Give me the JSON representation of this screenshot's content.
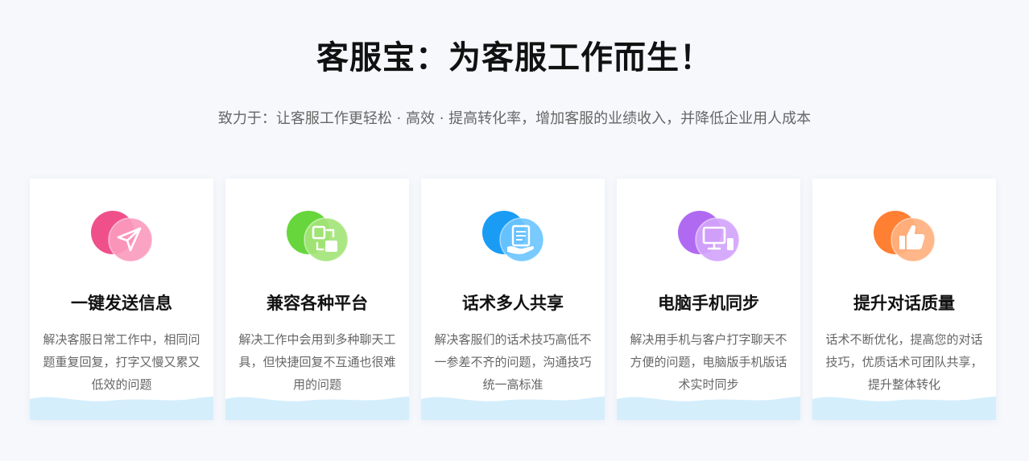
{
  "header": {
    "title": "客服宝：为客服工作而生！",
    "subtitle": "致力于：让客服工作更轻松 · 高效 · 提高转化率，增加客服的业绩收入，并降低企业用人成本"
  },
  "features": [
    {
      "icon": "paper-plane-icon",
      "title": "一键发送信息",
      "description": "解决客服日常工作中，相同问题重复回复，打字又慢又累又低效的问题",
      "color_back": "#f0508a",
      "color_front": "#fb9bbd"
    },
    {
      "icon": "sync-icon",
      "title": "兼容各种平台",
      "description": "解决工作中会用到多种聊天工具，但快捷回复不互通也很难用的问题",
      "color_back": "#66d63c",
      "color_front": "#a4e47a"
    },
    {
      "icon": "document-hand-icon",
      "title": "话术多人共享",
      "description": "解决客服们的话术技巧高低不一参差不齐的问题，沟通技巧统一高标准",
      "color_back": "#1a9cf5",
      "color_front": "#6cc6ff"
    },
    {
      "icon": "computer-phone-icon",
      "title": "电脑手机同步",
      "description": "解决用手机与客户打字聊天不方便的问题，电脑版手机版话术实时同步",
      "color_back": "#b06af2",
      "color_front": "#d2a4fb"
    },
    {
      "icon": "thumbs-up-icon",
      "title": "提升对话质量",
      "description": "话术不断优化，提高您的对话技巧，优质话术可团队共享，提升整体转化",
      "color_back": "#ff7f33",
      "color_front": "#ffb17f"
    }
  ],
  "wave_color": "#d4eefc"
}
